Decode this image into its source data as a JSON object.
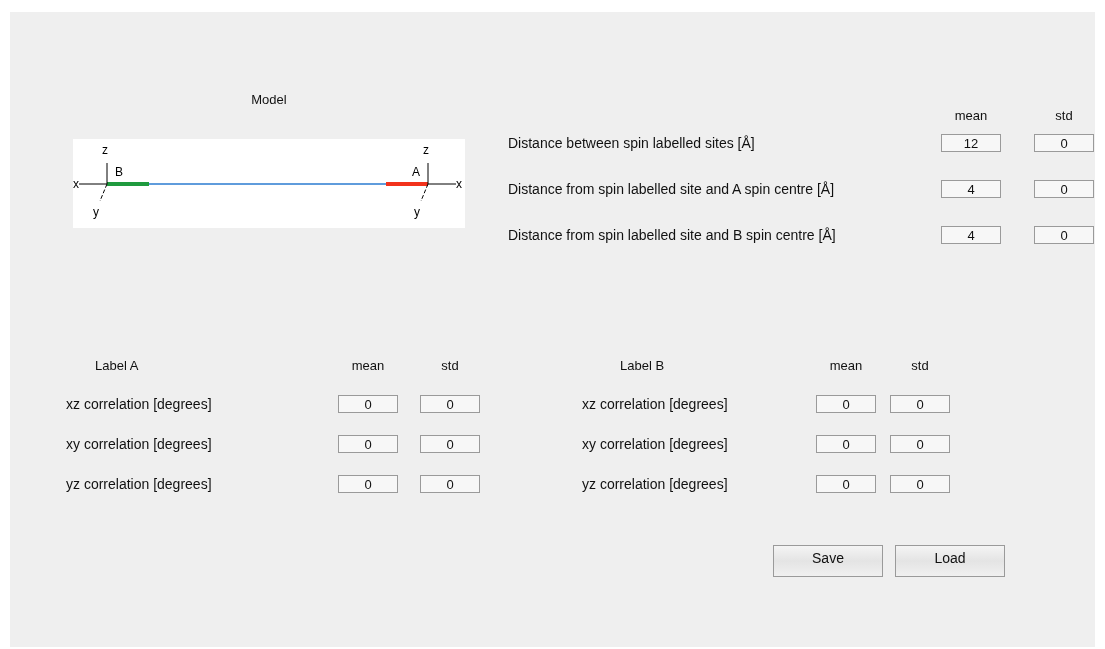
{
  "model": {
    "title": "Model",
    "frames": [
      {
        "kind": "left",
        "site": "B",
        "color": "#1f9a3e",
        "x": "x",
        "y": "y",
        "z": "z"
      },
      {
        "kind": "right",
        "site": "A",
        "color": "#f2321c",
        "x": "x",
        "y": "y",
        "z": "z"
      }
    ]
  },
  "distances": {
    "columns": [
      "mean",
      "std"
    ],
    "rows": [
      {
        "label": "Distance between spin labelled sites [Å]",
        "mean": "12",
        "std": "0"
      },
      {
        "label": "Distance from spin labelled site and A spin centre [Å]",
        "mean": "4",
        "std": "0"
      },
      {
        "label": "Distance from spin labelled site and B spin centre [Å]",
        "mean": "4",
        "std": "0"
      }
    ]
  },
  "label_groups": [
    {
      "title": "Label A",
      "columns": [
        "mean",
        "std"
      ],
      "rows": [
        {
          "label": "xz correlation [degrees]",
          "mean": "0",
          "std": "0"
        },
        {
          "label": "xy correlation [degrees]",
          "mean": "0",
          "std": "0"
        },
        {
          "label": "yz correlation [degrees]",
          "mean": "0",
          "std": "0"
        }
      ]
    },
    {
      "title": "Label B",
      "columns": [
        "mean",
        "std"
      ],
      "rows": [
        {
          "label": "xz correlation [degrees]",
          "mean": "0",
          "std": "0"
        },
        {
          "label": "xy correlation [degrees]",
          "mean": "0",
          "std": "0"
        },
        {
          "label": "yz correlation [degrees]",
          "mean": "0",
          "std": "0"
        }
      ]
    }
  ],
  "buttons": [
    "Save",
    "Load"
  ]
}
